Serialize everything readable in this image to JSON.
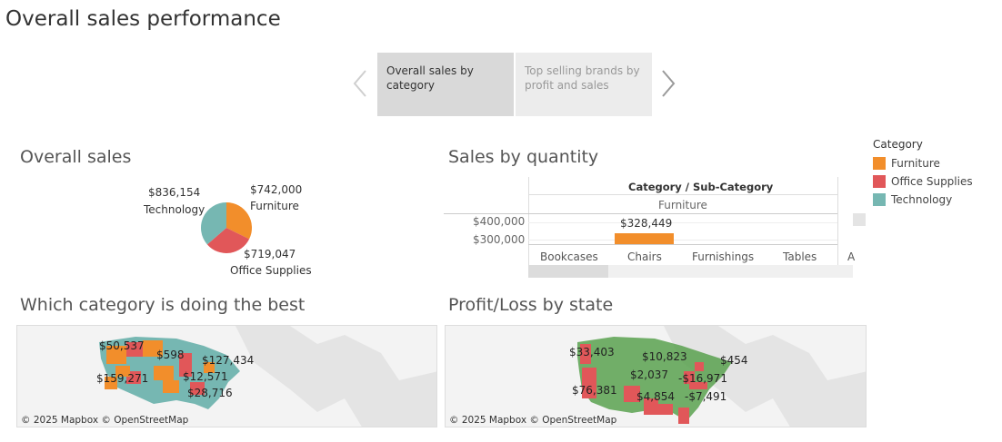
{
  "page": {
    "title": "Overall sales performance"
  },
  "story": {
    "prev_icon": "chevron-left-icon",
    "next_icon": "chevron-right-icon",
    "tabs": [
      {
        "label": "Overall sales by category"
      },
      {
        "label": "Top selling brands by profit and sales"
      }
    ]
  },
  "overall_sales": {
    "title": "Overall sales",
    "slices": [
      {
        "category": "Furniture",
        "value": 742000,
        "value_label": "$742,000",
        "color": "#f28e2b"
      },
      {
        "category": "Office Supplies",
        "value": 719047,
        "value_label": "$719,047",
        "color": "#e15759"
      },
      {
        "category": "Technology",
        "value": 836154,
        "value_label": "$836,154",
        "color": "#76b7b2"
      }
    ]
  },
  "sales_by_quantity": {
    "title": "Sales by quantity",
    "header": "Category / Sub-Category",
    "group": "Furniture",
    "y_ticks": [
      "$400,000",
      "$300,000"
    ],
    "subcategories": [
      "Bookcases",
      "Chairs",
      "Furnishings",
      "Tables",
      "A"
    ],
    "bar_value_label": "$328,449"
  },
  "legend": {
    "title": "Category",
    "items": [
      {
        "label": "Furniture",
        "color": "#f28e2b"
      },
      {
        "label": "Office Supplies",
        "color": "#e15759"
      },
      {
        "label": "Technology",
        "color": "#76b7b2"
      }
    ]
  },
  "best_category": {
    "title": "Which category is doing the best",
    "labels": [
      "$50,537",
      "$598",
      "$127,434",
      "$159,271",
      "$12,571",
      "$28,716"
    ],
    "attribution": "© 2025 Mapbox  © OpenStreetMap"
  },
  "profit_loss": {
    "title": "Profit/Loss by state",
    "labels": [
      "$33,403",
      "$10,823",
      "$454",
      "$2,037",
      "-$16,971",
      "$76,381",
      "$4,854",
      "-$7,491"
    ],
    "attribution": "© 2025 Mapbox  © OpenStreetMap"
  }
}
